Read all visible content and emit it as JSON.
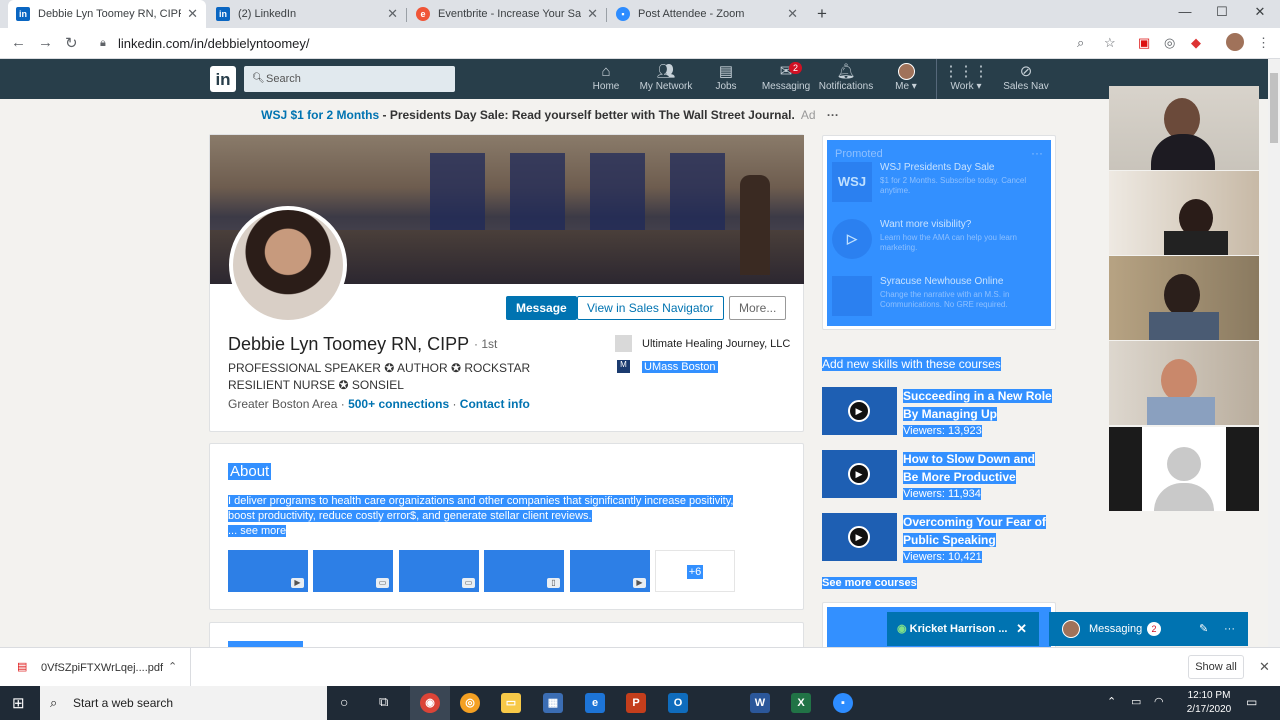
{
  "browser": {
    "tabs": [
      {
        "title": "Debbie Lyn Toomey RN, CIPP | Li",
        "favicon": "linkedin-icon",
        "active": true
      },
      {
        "title": "(2) LinkedIn",
        "favicon": "linkedin-icon",
        "active": false
      },
      {
        "title": "Eventbrite - Increase Your Sales",
        "favicon": "eventbrite-icon",
        "active": false
      },
      {
        "title": "Post Attendee - Zoom",
        "favicon": "zoom-icon",
        "active": false
      }
    ],
    "url": "linkedin.com/in/debbielyntoomey/"
  },
  "linkedin_nav": {
    "search_placeholder": "Search",
    "items": [
      {
        "label": "Home",
        "icon": "home-icon"
      },
      {
        "label": "My Network",
        "icon": "network-icon"
      },
      {
        "label": "Jobs",
        "icon": "briefcase-icon"
      },
      {
        "label": "Messaging",
        "icon": "messaging-icon",
        "badge": "2"
      },
      {
        "label": "Notifications",
        "icon": "bell-icon"
      },
      {
        "label": "Me ▾",
        "icon": "avatar"
      },
      {
        "label": "Work ▾",
        "icon": "grid-icon"
      },
      {
        "label": "Sales Nav",
        "icon": "compass-icon"
      }
    ]
  },
  "ad": {
    "link": "WSJ $1 for 2 Months",
    "text": " - Presidents Day Sale: Read yourself better with The Wall Street Journal.",
    "tag": "Ad"
  },
  "profile": {
    "actions": {
      "message": "Message",
      "sales_nav": "View in Sales Navigator",
      "more": "More..."
    },
    "name": "Debbie Lyn Toomey RN, CIPP",
    "degree": "1st",
    "headline": "PROFESSIONAL SPEAKER ✪ AUTHOR ✪ ROCKSTAR RESILIENT NURSE ✪ SONSIEL",
    "location": "Greater Boston Area",
    "connections": "500+ connections",
    "contact": "Contact info",
    "experience": "Ultimate Healing Journey, LLC",
    "education": "UMass Boston"
  },
  "about": {
    "title": "About",
    "text": "I deliver programs to health care organizations and other companies that significantly increase positivity, boost productivity, reduce costly error$, and generate stellar client reviews.",
    "see_more": "... see more",
    "extra_media": "+6"
  },
  "promoted": {
    "header": "Promoted",
    "items": [
      {
        "logo": "WSJ",
        "title": "WSJ Presidents Day Sale",
        "sub": "$1 for 2 Months. Subscribe today. Cancel anytime."
      },
      {
        "logo": "▷",
        "title": "Want more visibility?",
        "sub": "Learn how the AMA can help you learn marketing."
      },
      {
        "logo": "",
        "title": "Syracuse Newhouse Online",
        "sub": "Change the narrative with an M.S. in Communications. No GRE required."
      }
    ]
  },
  "courses": {
    "header": "Add new skills with these courses",
    "items": [
      {
        "title": "Succeeding in a New Role By Managing Up",
        "viewers": "Viewers: 13,923"
      },
      {
        "title": "How to Slow Down and Be More Productive",
        "viewers": "Viewers: 11,934"
      },
      {
        "title": "Overcoming Your Fear of Public Speaking",
        "viewers": "Viewers: 10,421"
      }
    ],
    "see_more": "See more courses"
  },
  "messaging": {
    "chat_name": "Kricket Harrison ...",
    "label": "Messaging",
    "badge": "2"
  },
  "download": {
    "file": "0VfSZpiFTXWrLqej....pdf",
    "show_all": "Show all"
  },
  "taskbar": {
    "search": "Start a web search",
    "time": "12:10 PM",
    "date": "2/17/2020"
  }
}
